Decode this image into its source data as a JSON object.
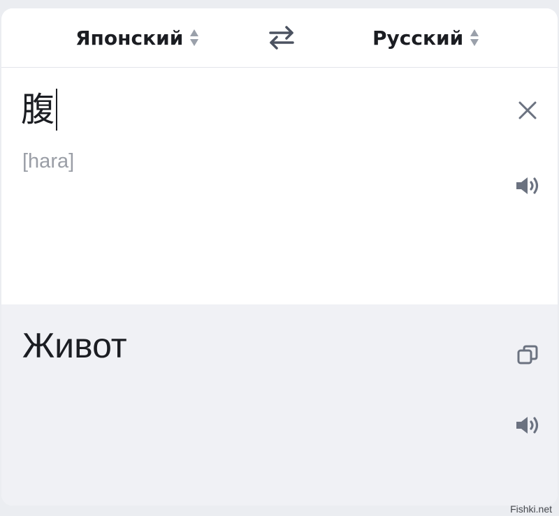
{
  "lang_bar": {
    "source_language": "Японский",
    "target_language": "Русский"
  },
  "source": {
    "text": "腹",
    "transliteration": "[hara]"
  },
  "target": {
    "text": "Живот"
  },
  "watermark": "Fishki.net",
  "icons": {
    "swap": "swap-arrows-icon",
    "clear": "close-icon",
    "speak": "speaker-icon",
    "copy": "copy-icon",
    "sort": "sort-arrows-icon"
  },
  "colors": {
    "text": "#1b1d22",
    "muted": "#9a9ea6",
    "icon": "#6b7280",
    "target_bg": "#f0f1f5"
  }
}
